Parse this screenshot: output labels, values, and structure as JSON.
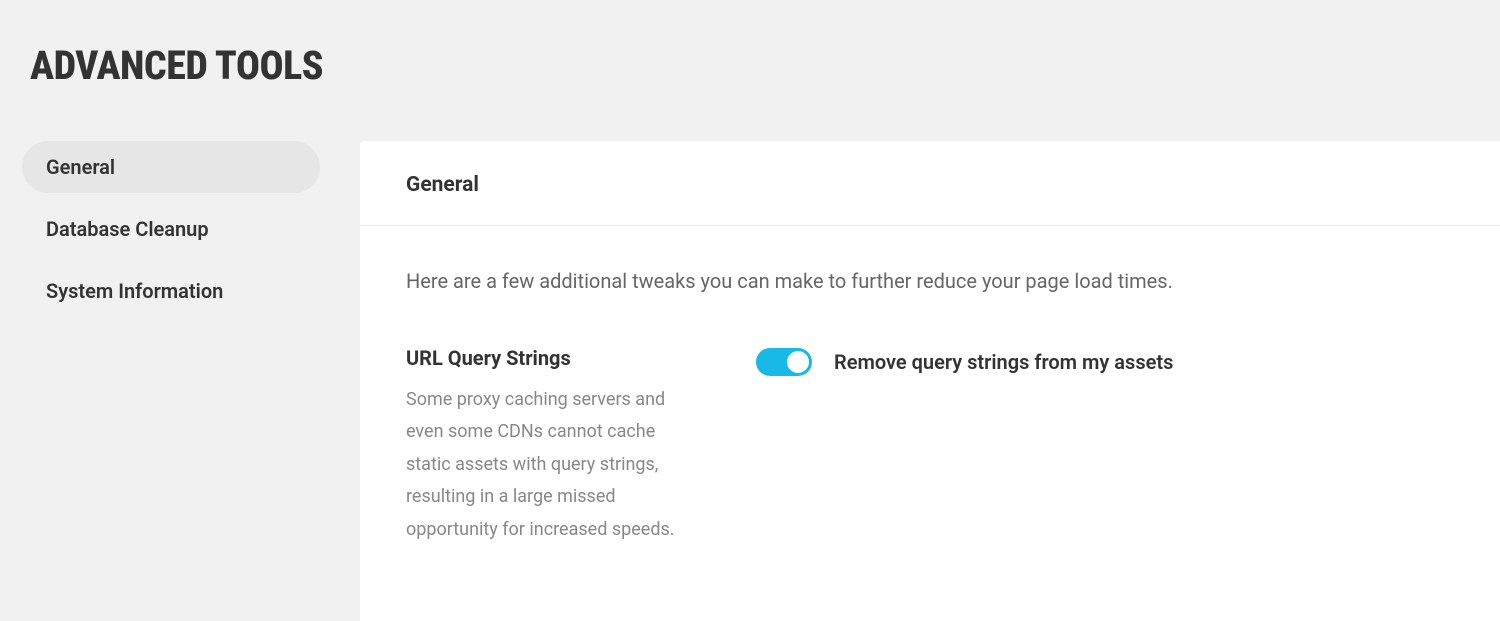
{
  "header": {
    "title": "ADVANCED TOOLS"
  },
  "sidebar": {
    "items": [
      {
        "label": "General",
        "active": true
      },
      {
        "label": "Database Cleanup",
        "active": false
      },
      {
        "label": "System Information",
        "active": false
      }
    ]
  },
  "panel": {
    "title": "General",
    "intro": "Here are a few additional tweaks you can make to further reduce your page load times.",
    "settings": [
      {
        "title": "URL Query Strings",
        "description": "Some proxy caching servers and even some CDNs cannot cache static assets with query strings, resulting in a large missed opportunity for increased speeds.",
        "toggle_label": "Remove query strings from my assets",
        "toggle_on": true
      }
    ]
  },
  "colors": {
    "accent": "#18b9e6",
    "page_bg": "#f1f1f1",
    "panel_bg": "#ffffff",
    "sidebar_active_bg": "#e6e6e6",
    "text_primary": "#333333",
    "text_secondary": "#666666",
    "text_muted": "#888888"
  }
}
